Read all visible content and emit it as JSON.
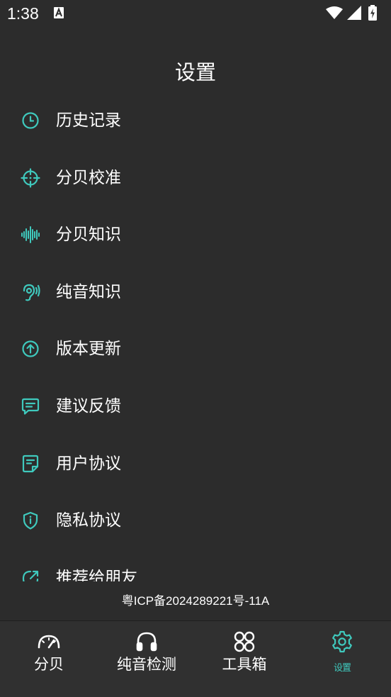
{
  "status_bar": {
    "time": "1:38"
  },
  "page": {
    "title": "设置"
  },
  "settings": {
    "items": [
      {
        "label": "历史记录",
        "icon": "clock-icon"
      },
      {
        "label": "分贝校准",
        "icon": "crosshair-icon"
      },
      {
        "label": "分贝知识",
        "icon": "soundwave-icon"
      },
      {
        "label": "纯音知识",
        "icon": "ear-icon"
      },
      {
        "label": "版本更新",
        "icon": "arrow-up-circle-icon"
      },
      {
        "label": "建议反馈",
        "icon": "message-icon"
      },
      {
        "label": "用户协议",
        "icon": "document-icon"
      },
      {
        "label": "隐私协议",
        "icon": "shield-icon"
      },
      {
        "label": "推荐给朋友",
        "icon": "share-icon"
      }
    ]
  },
  "footer": {
    "icp": "粤ICP备2024289221号-11A"
  },
  "bottom_nav": {
    "tabs": [
      {
        "label": "分贝",
        "icon": "speedometer-icon"
      },
      {
        "label": "纯音检测",
        "icon": "headphones-icon"
      },
      {
        "label": "工具箱",
        "icon": "grid-icon"
      },
      {
        "label": "设置",
        "icon": "gear-icon",
        "active": true
      }
    ]
  },
  "colors": {
    "background": "#2c2c2c",
    "accent": "#3fc9bd",
    "text": "#ffffff",
    "nav_background": "#303030"
  }
}
